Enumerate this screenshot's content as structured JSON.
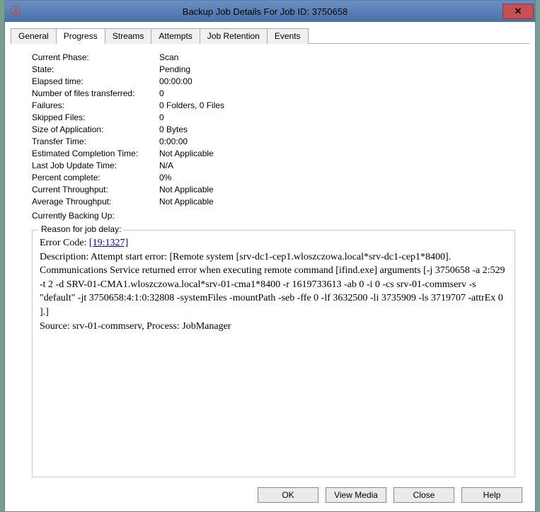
{
  "window": {
    "title": "Backup Job Details For Job ID: 3750658"
  },
  "tabs": {
    "items": [
      {
        "label": "General"
      },
      {
        "label": "Progress"
      },
      {
        "label": "Streams"
      },
      {
        "label": "Attempts"
      },
      {
        "label": "Job Retention"
      },
      {
        "label": "Events"
      }
    ],
    "active_index": 1
  },
  "fields": [
    {
      "label": "Current Phase:",
      "value": "Scan"
    },
    {
      "label": "State:",
      "value": "Pending"
    },
    {
      "label": "Elapsed time:",
      "value": "00:00:00"
    },
    {
      "label": "Number of files transferred:",
      "value": "0"
    },
    {
      "label": "Failures:",
      "value": "0 Folders, 0 Files"
    },
    {
      "label": "Skipped Files:",
      "value": "0"
    },
    {
      "label": "Size of Application:",
      "value": "0 Bytes"
    },
    {
      "label": "Transfer Time:",
      "value": "0:00:00"
    },
    {
      "label": "Estimated Completion Time:",
      "value": "Not Applicable"
    },
    {
      "label": "Last Job Update Time:",
      "value": "N/A"
    },
    {
      "label": "Percent complete:",
      "value": "0%"
    },
    {
      "label": "Current Throughput:",
      "value": "Not Applicable"
    },
    {
      "label": "Average Throughput:",
      "value": "Not Applicable"
    },
    {
      "label": "Currently Backing Up:",
      "value": ""
    }
  ],
  "delay": {
    "legend": "Reason for job delay:",
    "error_prefix": "Error Code: ",
    "error_code": "[19:1327]",
    "desc": "Description: Attempt start error: [Remote system [srv-dc1-cep1.wloszczowa.local*srv-dc1-cep1*8400]. Communications Service returned error when executing remote command [ifind.exe] arguments [-j 3750658 -a 2:529 -t 2 -d SRV-01-CMA1.wloszczowa.local*srv-01-cma1*8400 -r 1619733613 -ab 0 -i 0 -cs srv-01-commserv -s \"default\" -jt 3750658:4:1:0:32808 -systemFiles -mountPath -seb -ffe 0 -lf 3632500 -li 3735909 -ls 3719707 -attrEx 0 ].]",
    "source": "Source: srv-01-commserv, Process: JobManager"
  },
  "buttons": {
    "ok": "OK",
    "view_media": "View Media",
    "close": "Close",
    "help": "Help"
  }
}
